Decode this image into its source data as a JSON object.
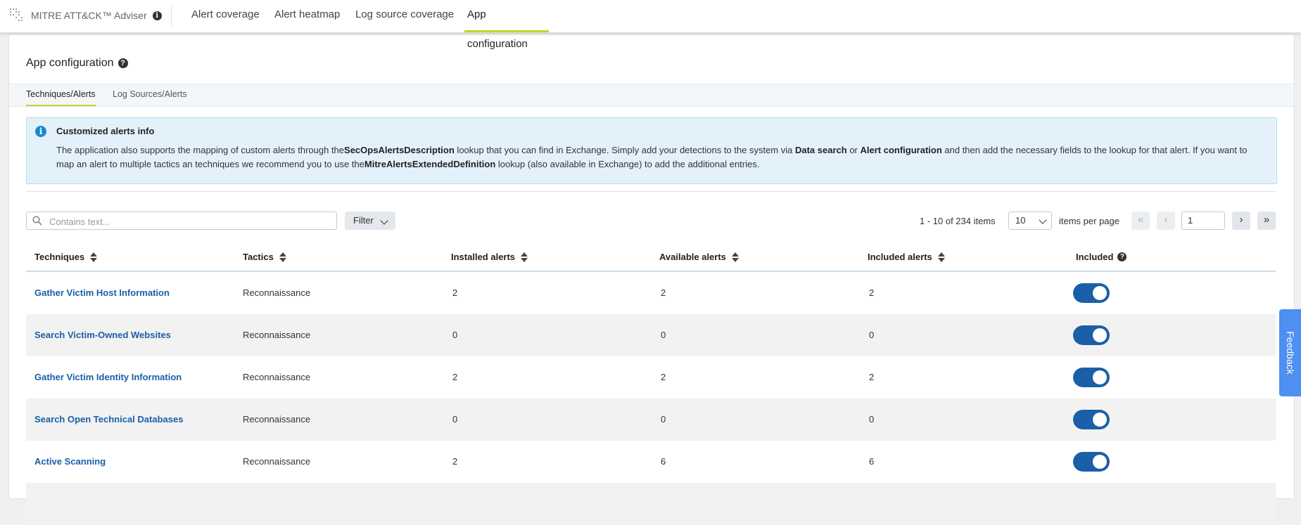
{
  "app": {
    "name": "MITRE ATT&CK™ Adviser"
  },
  "nav": {
    "tabs": [
      "Alert coverage",
      "Alert heatmap",
      "Log source coverage",
      "App configuration"
    ],
    "active": "App configuration"
  },
  "page": {
    "title": "App configuration"
  },
  "subtabs": {
    "items": [
      "Techniques/Alerts",
      "Log Sources/Alerts"
    ],
    "active": "Techniques/Alerts"
  },
  "alert": {
    "title": "Customized alerts info",
    "p1": "The application also supports the mapping of custom alerts through the",
    "b1": "SecOpsAlertsDescription",
    "p2": " lookup that you can find in Exchange. Simply add your detections to the system via ",
    "b2": "Data search",
    "p3": " or ",
    "b3": "Alert configuration",
    "p4": " and then add the necessary fields to the lookup for that alert. If you want to map an alert to multiple tactics an techniques we recommend you to use the",
    "b4": "MitreAlertsExtendedDefinition",
    "p5": " lookup (also available in Exchange) to add the additional entries."
  },
  "toolbar": {
    "search_placeholder": "Contains text...",
    "filter_label": "Filter",
    "range": "1 - 10 of 234 items",
    "per_page_value": "10",
    "per_page_label": "items per page",
    "page_value": "1"
  },
  "table": {
    "headers": {
      "techniques": "Techniques",
      "tactics": "Tactics",
      "installed": "Installed alerts",
      "available": "Available alerts",
      "included_alerts": "Included alerts",
      "included": "Included"
    },
    "rows": [
      {
        "technique": "Gather Victim Host Information",
        "tactic": "Reconnaissance",
        "installed": "2",
        "available": "2",
        "included_alerts": "2",
        "included": true
      },
      {
        "technique": "Search Victim-Owned Websites",
        "tactic": "Reconnaissance",
        "installed": "0",
        "available": "0",
        "included_alerts": "0",
        "included": true
      },
      {
        "technique": "Gather Victim Identity Information",
        "tactic": "Reconnaissance",
        "installed": "2",
        "available": "2",
        "included_alerts": "2",
        "included": true
      },
      {
        "technique": "Search Open Technical Databases",
        "tactic": "Reconnaissance",
        "installed": "0",
        "available": "0",
        "included_alerts": "0",
        "included": true
      },
      {
        "technique": "Active Scanning",
        "tactic": "Reconnaissance",
        "installed": "2",
        "available": "6",
        "included_alerts": "6",
        "included": true
      }
    ]
  },
  "feedback": {
    "label": "Feedback"
  },
  "colors": {
    "accent": "#c5d42a",
    "link": "#1a5fa8",
    "toggle_on": "#1a5fa8",
    "info_bg": "#e3f2fa",
    "feedback": "#4e8ff0"
  },
  "icons": {
    "logo": "mitre-logo-icon",
    "info": "info-icon",
    "help": "help-icon",
    "search": "search-icon",
    "chevron": "chevron-down-icon"
  }
}
